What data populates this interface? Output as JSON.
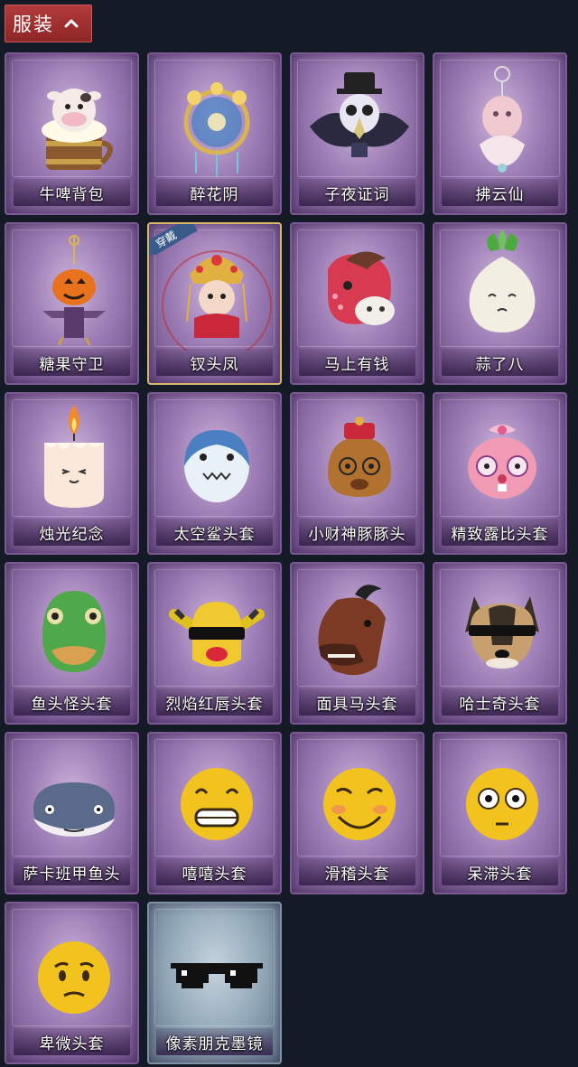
{
  "header": {
    "label": "服装"
  },
  "items": [
    {
      "name": "牛啤背包",
      "icon": "cow-beer-backpack-icon"
    },
    {
      "name": "醉花阴",
      "icon": "flower-dreamcatcher-icon"
    },
    {
      "name": "子夜证词",
      "icon": "raven-plague-mask-icon"
    },
    {
      "name": "拂云仙",
      "icon": "cloud-fairy-ornament-icon"
    },
    {
      "name": "糖果守卫",
      "icon": "pumpkin-scarecrow-icon"
    },
    {
      "name": "钗头凤",
      "icon": "phoenix-crown-doll-icon",
      "badge": "穿戴"
    },
    {
      "name": "马上有钱",
      "icon": "red-horse-head-icon"
    },
    {
      "name": "蒜了八",
      "icon": "garlic-icon"
    },
    {
      "name": "烛光纪念",
      "icon": "candle-icon"
    },
    {
      "name": "太空鲨头套",
      "icon": "space-shark-head-icon"
    },
    {
      "name": "小财神豚豚头",
      "icon": "capybara-fortune-head-icon"
    },
    {
      "name": "精致露比头套",
      "icon": "pink-beaver-head-icon"
    },
    {
      "name": "鱼头怪头套",
      "icon": "fish-monster-head-icon"
    },
    {
      "name": "烈焰红唇头套",
      "icon": "yellow-mask-sunglasses-icon"
    },
    {
      "name": "面具马头套",
      "icon": "horse-mask-icon"
    },
    {
      "name": "哈士奇头套",
      "icon": "husky-sunglasses-icon"
    },
    {
      "name": "萨卡班甲鱼头",
      "icon": "sacabambaspis-head-icon"
    },
    {
      "name": "嘻嘻头套",
      "icon": "grinning-emoji-head-icon"
    },
    {
      "name": "滑稽头套",
      "icon": "funny-emoji-head-icon"
    },
    {
      "name": "呆滞头套",
      "icon": "dazed-emoji-head-icon"
    },
    {
      "name": "卑微头套",
      "icon": "humble-emoji-head-icon"
    },
    {
      "name": "像素朋克墨镜",
      "icon": "pixel-sunglasses-icon"
    }
  ],
  "colors": {
    "background": "#141a26",
    "card_purple": "#9d7db5",
    "card_silver": "#93a9b9",
    "header_red": "#a63232",
    "equipped_border": "#d8b96a",
    "badge_blue": "#3b5a8c"
  }
}
